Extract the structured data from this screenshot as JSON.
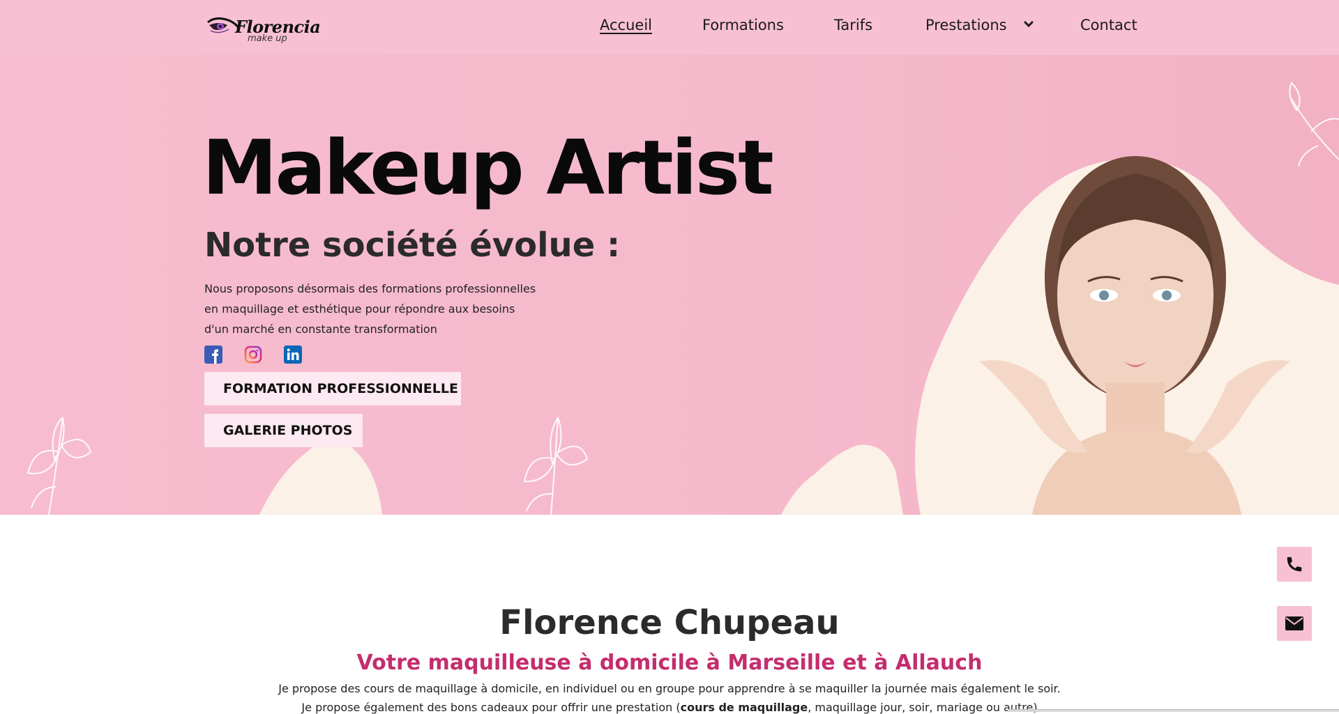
{
  "brand": {
    "name": "Florencia",
    "tagline": "make up"
  },
  "nav": {
    "items": [
      {
        "label": "Accueil",
        "active": true
      },
      {
        "label": "Formations",
        "active": false
      },
      {
        "label": "Tarifs",
        "active": false
      },
      {
        "label": "Prestations",
        "active": false,
        "icon": "chevron-down-icon"
      },
      {
        "label": "Contact",
        "active": false
      }
    ]
  },
  "hero": {
    "title": "Makeup Artist",
    "subtitle": "Notre société évolue :",
    "text_lines": [
      "Nous proposons désormais des formations professionnelles",
      "en maquillage et esthétique pour répondre aux besoins",
      "d'un marché en constante transformation"
    ],
    "social": [
      "facebook-icon",
      "instagram-icon",
      "linkedin-icon"
    ],
    "buttons": {
      "formation": "FORMATION PROFESSIONNELLE",
      "galerie": "GALERIE PHOTOS"
    }
  },
  "about": {
    "name": "Florence Chupeau",
    "tagline": "Votre maquilleuse à domicile à Marseille et à Allauch",
    "p1": "Je propose des cours de maquillage à domicile, en individuel ou en groupe pour apprendre à se maquiller la journée mais également le soir.",
    "p2_before": "Je propose également des bons cadeaux pour offrir une prestation (",
    "p2_bold": "cours de maquillage",
    "p2_after": ", maquillage jour, soir, mariage ou autre)"
  },
  "floating": [
    "phone-icon",
    "mail-icon"
  ],
  "colors": {
    "pink": "#f7c0d3",
    "accent": "#c42d6d",
    "cream": "#fbf1e6",
    "button_bg": "#fde9f1"
  }
}
